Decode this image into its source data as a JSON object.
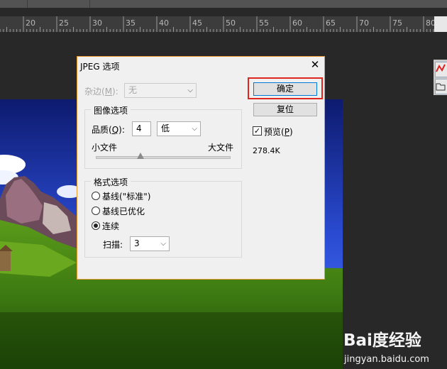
{
  "ruler": {
    "numbers": [
      "20",
      "25",
      "30",
      "35",
      "40",
      "45",
      "50",
      "55",
      "60",
      "65",
      "70",
      "75",
      "80"
    ]
  },
  "watermark": {
    "logo": "Bai度经验",
    "url": "jingyan.baidu.com"
  },
  "dialog": {
    "title": "JPEG 选项",
    "close": "✕",
    "noise_label_prefix": "杂边(",
    "noise_label_key": "M",
    "noise_label_suffix": "):",
    "noise_value": "无",
    "image_options": {
      "title": "图像选项",
      "quality_label_prefix": "品质(",
      "quality_key": "Q",
      "quality_label_suffix": "):",
      "quality_value": "4",
      "quality_level": "低",
      "small_file": "小文件",
      "large_file": "大文件",
      "slider_fraction": 0.33
    },
    "format_options": {
      "title": "格式选项",
      "options": [
        "基线(\"标准\")",
        "基线已优化",
        "连续"
      ],
      "selected": "连续",
      "scan_label": "扫描:",
      "scan_value": "3"
    },
    "ok": "确定",
    "reset": "复位",
    "preview_prefix": "预览(",
    "preview_key": "P",
    "preview_suffix": ")",
    "preview_checked": true,
    "file_size": "278.4K"
  }
}
